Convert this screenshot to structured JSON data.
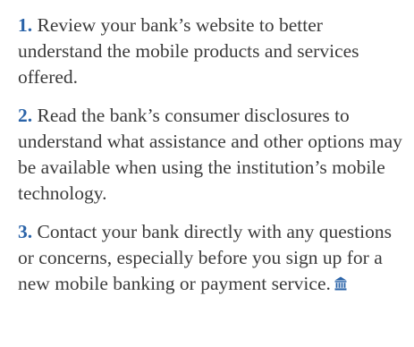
{
  "tips": [
    {
      "number": "1.",
      "text": "Review your bank’s website to better understand the mobile products and services offered."
    },
    {
      "number": "2.",
      "text": "Read the bank’s consumer disclosures to understand what assistance and other options may be available when using the institution’s mobile technology."
    },
    {
      "number": "3.",
      "text": "Contact your bank directly with any questions or concerns, especially before you sign up for a new mobile banking or payment service."
    }
  ],
  "end_icon": "bank-building-icon",
  "colors": {
    "number": "#2a63a8",
    "body_text": "#3b3b3b",
    "icon": "#2a63a8"
  }
}
